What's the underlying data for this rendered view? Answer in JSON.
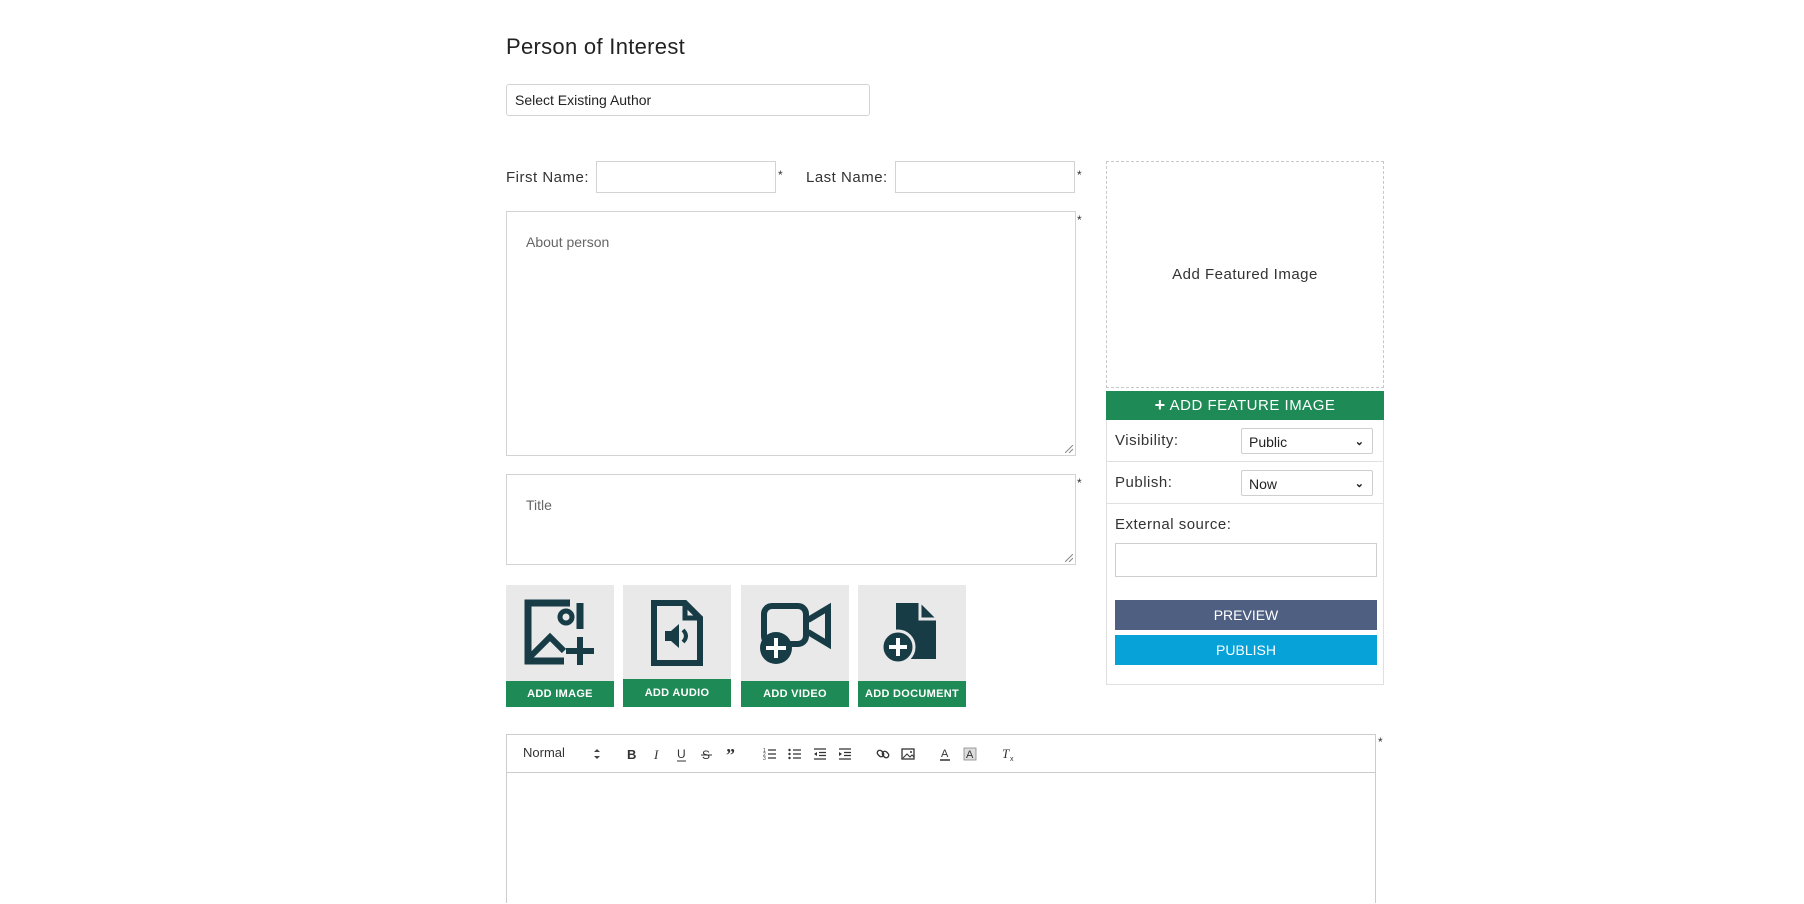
{
  "page": {
    "title": "Person of Interest"
  },
  "author": {
    "select_label": "Select Existing Author"
  },
  "fields": {
    "first_name_label": "First Name:",
    "last_name_label": "Last Name:",
    "required_mark": "*",
    "about_placeholder": "About person",
    "title_placeholder": "Title"
  },
  "media": [
    {
      "label": "ADD IMAGE",
      "icon": "add-image-icon"
    },
    {
      "label": "ADD AUDIO",
      "icon": "add-audio-icon"
    },
    {
      "label": "ADD VIDEO",
      "icon": "add-video-icon"
    },
    {
      "label": "ADD DOCUMENT",
      "icon": "add-document-icon"
    }
  ],
  "featured": {
    "placeholder": "Add Featured Image",
    "button_label": "ADD FEATURE IMAGE"
  },
  "sidebar": {
    "visibility_label": "Visibility:",
    "visibility_value": "Public",
    "publish_label": "Publish:",
    "publish_value": "Now",
    "external_source_label": "External source:",
    "preview_label": "PREVIEW",
    "publish_button_label": "PUBLISH"
  },
  "editor": {
    "format_value": "Normal",
    "toolbar_icons": [
      "bold-icon",
      "italic-icon",
      "underline-icon",
      "strike-icon",
      "quote-icon",
      "ordered-list-icon",
      "bullet-list-icon",
      "outdent-icon",
      "indent-icon",
      "link-icon",
      "image-icon",
      "font-color-icon",
      "background-color-icon",
      "clear-format-icon"
    ]
  },
  "colors": {
    "accent_green": "#1e8a55",
    "icon_dark": "#173c45",
    "preview_blue": "#4e5f82",
    "publish_cyan": "#06a2d8"
  }
}
